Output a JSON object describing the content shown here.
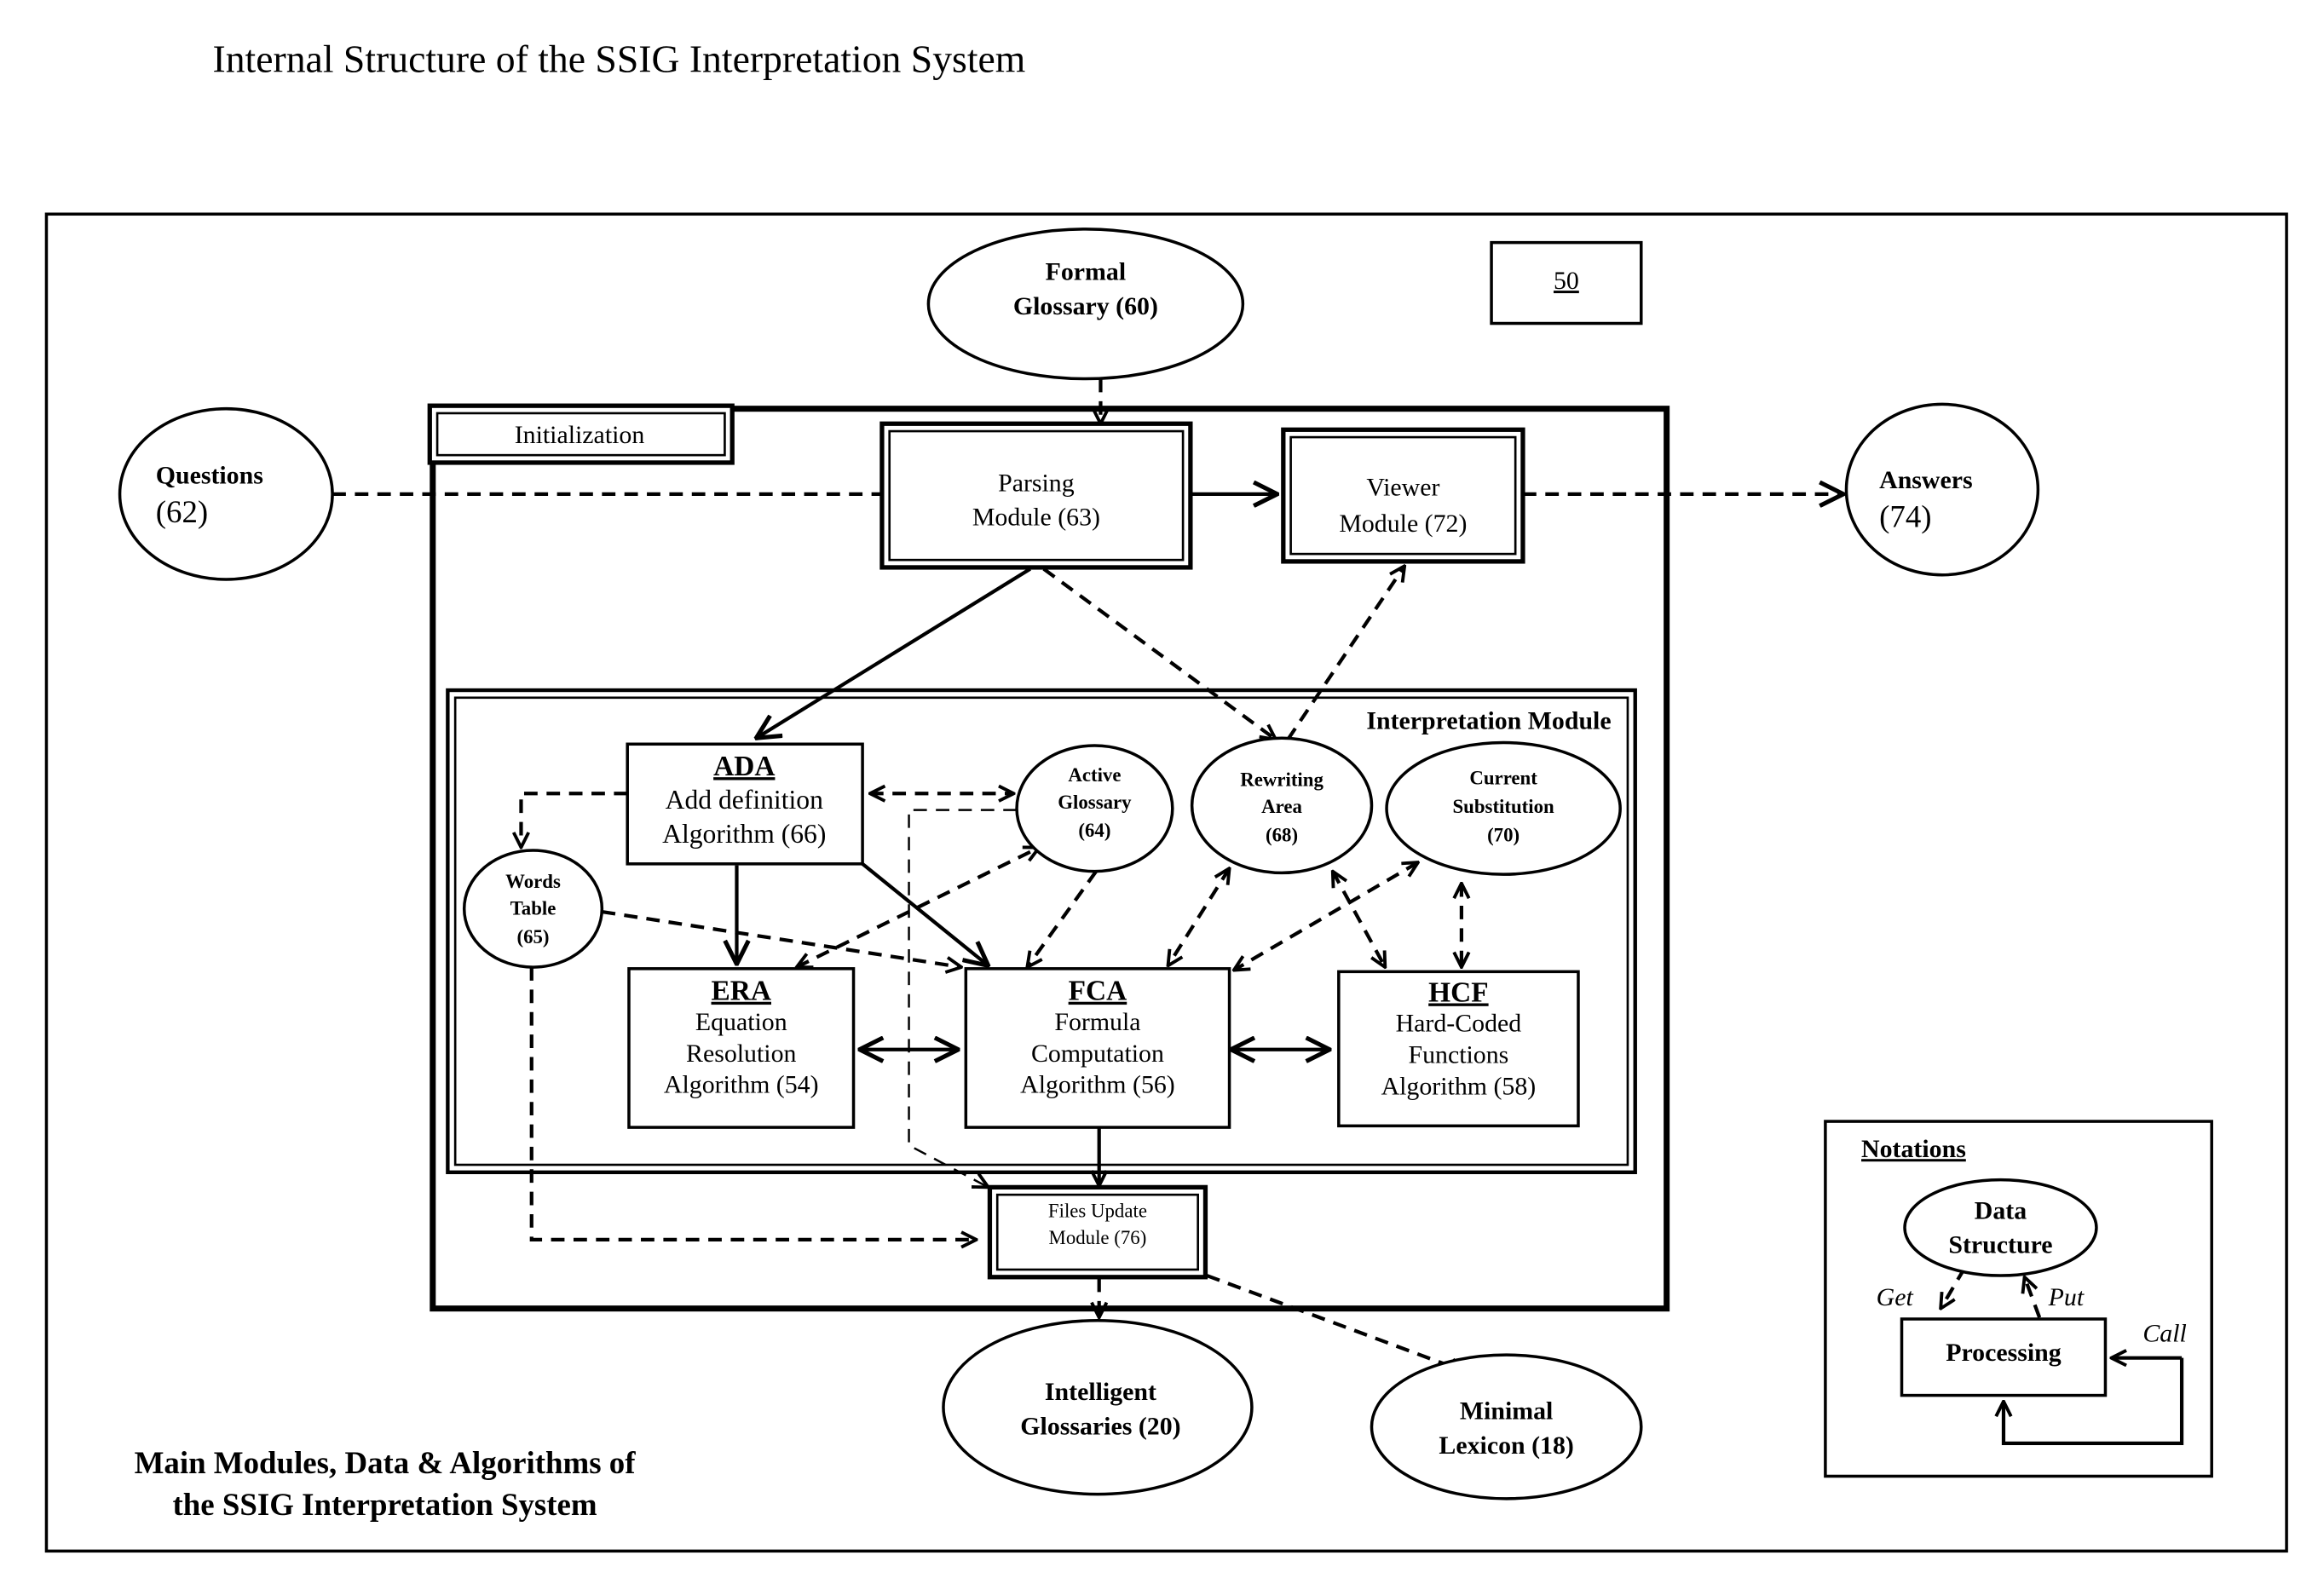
{
  "title": "Internal Structure of the SSIG Interpretation System",
  "figure_number": "50",
  "caption": {
    "line1": "Main Modules, Data & Algorithms of",
    "line2": "the SSIG Interpretation System"
  },
  "containers": {
    "initialization": "Initialization",
    "interpretation_module": "Interpretation Module"
  },
  "external": {
    "formal_glossary": {
      "line1": "Formal",
      "line2": "Glossary (60)"
    },
    "questions": {
      "line1": "Questions",
      "line2": "(62)"
    },
    "answers": {
      "line1": "Answers",
      "line2": "(74)"
    },
    "intelligent_glossaries": {
      "line1": "Intelligent",
      "line2": "Glossaries (20)"
    },
    "minimal_lexicon": {
      "line1": "Minimal",
      "line2": "Lexicon (18)"
    }
  },
  "modules": {
    "parsing": {
      "line1": "Parsing",
      "line2": "Module (63)"
    },
    "viewer": {
      "line1": "Viewer",
      "line2": "Module (72)"
    },
    "files_update": {
      "line1": "Files Update",
      "line2": "Module (76)"
    }
  },
  "data_structures": {
    "active_glossary": {
      "line1": "Active",
      "line2": "Glossary",
      "line3": "(64)"
    },
    "rewriting_area": {
      "line1": "Rewriting",
      "line2": "Area",
      "line3": "(68)"
    },
    "current_substitution": {
      "line1": "Current",
      "line2": "Substitution",
      "line3": "(70)"
    },
    "words_table": {
      "line1": "Words",
      "line2": "Table",
      "line3": "(65)"
    }
  },
  "algorithms": {
    "ada": {
      "abbr": "ADA",
      "line1": "Add definition",
      "line2": "Algorithm (66)"
    },
    "era": {
      "abbr": "ERA",
      "line1": "Equation",
      "line2": "Resolution",
      "line3": "Algorithm (54)"
    },
    "fca": {
      "abbr": "FCA",
      "line1": "Formula",
      "line2": "Computation",
      "line3": "Algorithm (56)"
    },
    "hcf": {
      "abbr": "HCF",
      "line1": "Hard-Coded",
      "line2": "Functions",
      "line3": "Algorithm (58)"
    }
  },
  "notations": {
    "title": "Notations",
    "data_structure": {
      "line1": "Data",
      "line2": "Structure"
    },
    "processing": "Processing",
    "get": "Get",
    "put": "Put",
    "call": "Call"
  },
  "edges": [
    {
      "from": "Formal Glossary (60)",
      "to": "Parsing Module (63)",
      "style": "dashed",
      "kind": "get"
    },
    {
      "from": "Questions (62)",
      "to": "Parsing Module (63)",
      "style": "dashed",
      "kind": "get"
    },
    {
      "from": "Parsing Module (63)",
      "to": "Viewer Module (72)",
      "style": "solid",
      "kind": "call"
    },
    {
      "from": "Viewer Module (72)",
      "to": "Answers (74)",
      "style": "dashed",
      "kind": "put"
    },
    {
      "from": "Parsing Module (63)",
      "to": "ADA (66)",
      "style": "solid",
      "kind": "call"
    },
    {
      "from": "Parsing Module (63)",
      "to": "Rewriting Area (68)",
      "style": "dashed",
      "kind": "put"
    },
    {
      "from": "Rewriting Area (68)",
      "to": "Viewer Module (72)",
      "style": "dashed",
      "kind": "get"
    },
    {
      "from": "ADA (66)",
      "to": "Active Glossary (64)",
      "style": "dashed",
      "kind": "get/put"
    },
    {
      "from": "ADA (66)",
      "to": "Words Table (65)",
      "style": "dashed",
      "kind": "put"
    },
    {
      "from": "ADA (66)",
      "to": "ERA (54)",
      "style": "solid",
      "kind": "call"
    },
    {
      "from": "ADA (66)",
      "to": "FCA (56)",
      "style": "solid",
      "kind": "call"
    },
    {
      "from": "ERA (54)",
      "to": "Active Glossary (64)",
      "style": "dashed",
      "kind": "get/put"
    },
    {
      "from": "Words Table (65)",
      "to": "FCA (56)",
      "style": "dashed",
      "kind": "get"
    },
    {
      "from": "Active Glossary (64)",
      "to": "FCA (56)",
      "style": "dashed",
      "kind": "get"
    },
    {
      "from": "Rewriting Area (68)",
      "to": "FCA (56)",
      "style": "dashed",
      "kind": "get/put"
    },
    {
      "from": "Current Substitution (70)",
      "to": "FCA (56)",
      "style": "dashed",
      "kind": "get/put"
    },
    {
      "from": "Rewriting Area (68)",
      "to": "HCF (58)",
      "style": "dashed",
      "kind": "get/put"
    },
    {
      "from": "Current Substitution (70)",
      "to": "HCF (58)",
      "style": "dashed",
      "kind": "get/put"
    },
    {
      "from": "ERA (54)",
      "to": "FCA (56)",
      "style": "solid",
      "kind": "call-both"
    },
    {
      "from": "FCA (56)",
      "to": "HCF (58)",
      "style": "solid",
      "kind": "call-both"
    },
    {
      "from": "FCA (56)",
      "to": "Files Update Module (76)",
      "style": "solid",
      "kind": "call"
    },
    {
      "from": "Active Glossary (64)",
      "to": "Files Update Module (76)",
      "style": "dashed",
      "kind": "get"
    },
    {
      "from": "Words Table (65)",
      "to": "Files Update Module (76)",
      "style": "dashed",
      "kind": "get"
    },
    {
      "from": "Files Update Module (76)",
      "to": "Intelligent Glossaries (20)",
      "style": "dashed",
      "kind": "put"
    },
    {
      "from": "Files Update Module (76)",
      "to": "Minimal Lexicon (18)",
      "style": "dashed",
      "kind": "put"
    }
  ]
}
